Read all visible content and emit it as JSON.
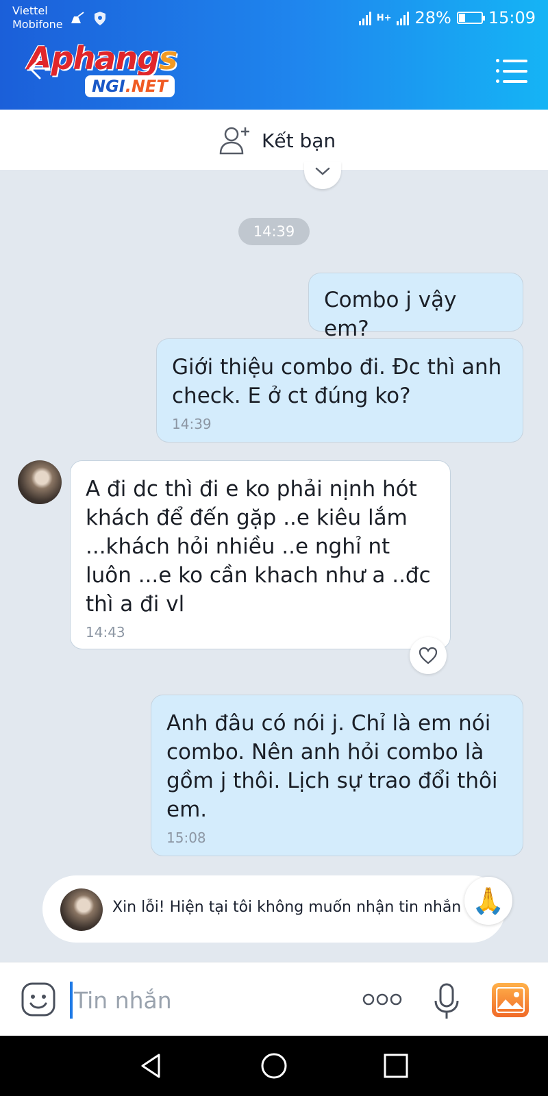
{
  "status": {
    "carrier_line1": "Viettel",
    "carrier_line2": "Mobifone",
    "network": "H+",
    "battery": "28%",
    "battery_level": 0.28,
    "time": "15:09"
  },
  "header": {
    "logo_main": "Aphang",
    "logo_main_s": "s",
    "logo_sub": "NGI",
    "logo_sub_net": ".NET",
    "back_icon": "back-arrow-icon",
    "menu_icon": "menu-icon"
  },
  "add_friend": {
    "label": "Kết bạn",
    "icon": "add-user-icon"
  },
  "chat": {
    "time_separator": "14:39",
    "messages": [
      {
        "from": "me",
        "text": "Combo j vậy em?",
        "time": ""
      },
      {
        "from": "me",
        "text": "Giới thiệu combo đi. Đc thì anh check. E ở ct đúng ko?",
        "time": "14:39"
      },
      {
        "from": "them",
        "text": "A đi dc thì đi e ko phải nịnh hót khách để đến gặp ..e kiêu lắm ...khách hỏi nhiều ..e nghỉ nt luôn ...e ko cần khach như a ..đc thì a đi vl",
        "time": "14:43"
      },
      {
        "from": "me",
        "text": "Anh đâu có nói j. Chỉ là em nói combo. Nên anh hỏi combo là gồm j thôi. Lịch sự trao đổi thôi em.",
        "time": "15:08"
      }
    ],
    "notice": "Xin lỗi! Hiện tại tôi không muốn nhận tin nhắn",
    "reaction_emoji": "🙏"
  },
  "input": {
    "placeholder": "Tin nhắn"
  },
  "colors": {
    "header_start": "#1b5fd9",
    "header_end": "#15b4f5",
    "my_bubble": "#d4ecfc",
    "accent": "#1f7ae6"
  }
}
